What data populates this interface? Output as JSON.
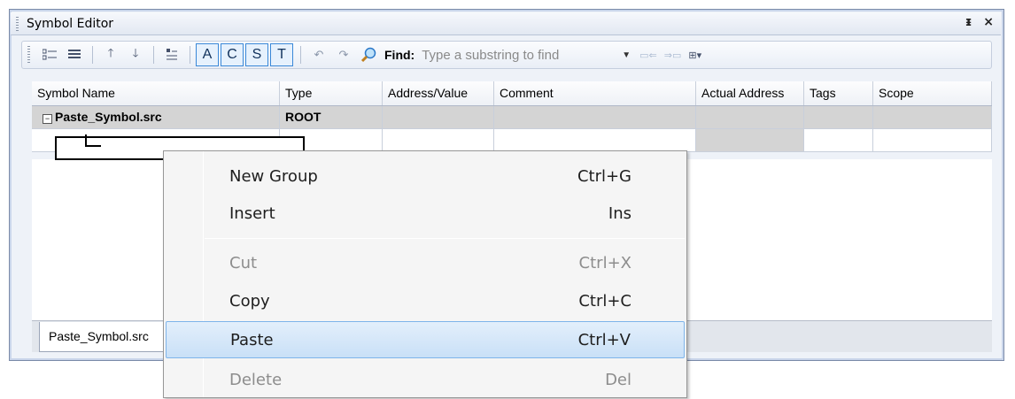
{
  "window": {
    "title": "Symbol Editor",
    "pin": "ᵻ",
    "close": "×"
  },
  "toolbar": {
    "letters": [
      "A",
      "C",
      "S",
      "T"
    ],
    "find_label": "Find:",
    "find_placeholder": "Type a substring to find"
  },
  "grid": {
    "columns": [
      "Symbol Name",
      "Type",
      "Address/Value",
      "Comment",
      "Actual Address",
      "Tags",
      "Scope"
    ],
    "root_row": {
      "name": "Paste_Symbol.src",
      "type": "ROOT"
    }
  },
  "tab": {
    "label": "Paste_Symbol.src"
  },
  "context_menu": {
    "items": [
      {
        "label": "New Group",
        "shortcut": "Ctrl+G"
      },
      {
        "label": "Insert",
        "shortcut": "Ins"
      },
      {
        "label": "Cut",
        "shortcut": "Ctrl+X"
      },
      {
        "label": "Copy",
        "shortcut": "Ctrl+C"
      },
      {
        "label": "Paste",
        "shortcut": "Ctrl+V"
      },
      {
        "label": "Delete",
        "shortcut": "Del"
      }
    ]
  }
}
